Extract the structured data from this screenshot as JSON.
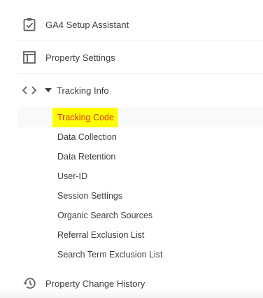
{
  "nav": {
    "setup_assistant": {
      "label": "GA4 Setup Assistant",
      "icon": "clipboard-check-icon"
    },
    "property_settings": {
      "label": "Property Settings",
      "icon": "window-layout-icon"
    },
    "tracking_info": {
      "label": "Tracking Info",
      "icon": "code-brackets-icon",
      "expanded": true,
      "items": [
        {
          "label": "Tracking Code",
          "highlighted": true
        },
        {
          "label": "Data Collection"
        },
        {
          "label": "Data Retention"
        },
        {
          "label": "User-ID"
        },
        {
          "label": "Session Settings"
        },
        {
          "label": "Organic Search Sources"
        },
        {
          "label": "Referral Exclusion List"
        },
        {
          "label": "Search Term Exclusion List"
        }
      ]
    },
    "property_change_history": {
      "label": "Property Change History",
      "icon": "history-icon"
    }
  },
  "colors": {
    "text": "#3c4043",
    "icon": "#5f6368",
    "highlight_bg": "#ffff00",
    "highlight_text": "#d93025",
    "divider": "#e8eaed"
  }
}
